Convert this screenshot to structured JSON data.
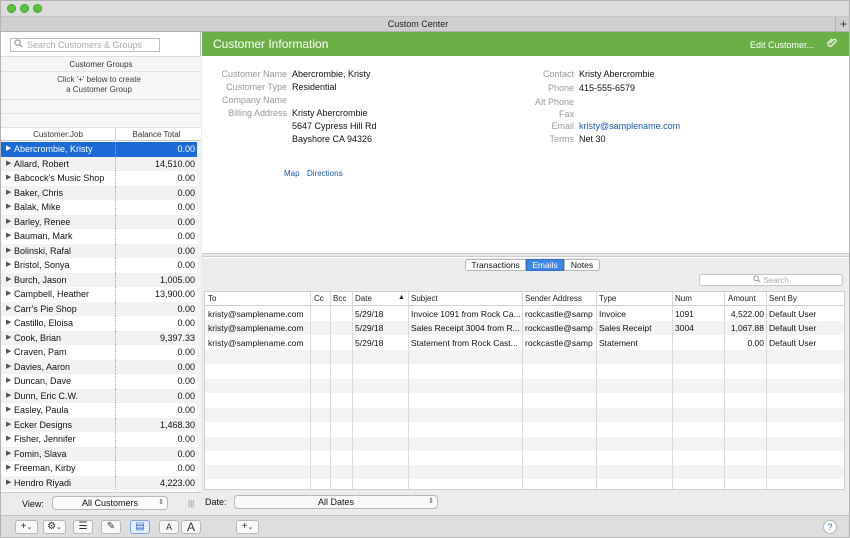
{
  "window": {
    "title": "Custom Center",
    "new_tab": "+"
  },
  "sidebar": {
    "search_placeholder": "Search Customers & Groups",
    "groups_header": "Customer Groups",
    "groups_hint": [
      "Click '+' below to create",
      "a Customer Group"
    ],
    "columns": [
      "Customer:Job",
      "Balance Total"
    ],
    "customers": [
      {
        "name": "Abercrombie, Kristy",
        "balance": "0.00",
        "selected": true
      },
      {
        "name": "Allard, Robert",
        "balance": "14,510.00"
      },
      {
        "name": "Babcock's Music Shop",
        "balance": "0.00"
      },
      {
        "name": "Baker, Chris",
        "balance": "0.00"
      },
      {
        "name": "Balak, Mike",
        "balance": "0.00"
      },
      {
        "name": "Barley, Renee",
        "balance": "0.00"
      },
      {
        "name": "Bauman, Mark",
        "balance": "0.00"
      },
      {
        "name": "Bolinski, Rafal",
        "balance": "0.00"
      },
      {
        "name": "Bristol, Sonya",
        "balance": "0.00"
      },
      {
        "name": "Burch, Jason",
        "balance": "1,005.00"
      },
      {
        "name": "Campbell, Heather",
        "balance": "13,900.00"
      },
      {
        "name": "Carr's Pie Shop",
        "balance": "0.00"
      },
      {
        "name": "Castillo, Eloisa",
        "balance": "0.00"
      },
      {
        "name": "Cook, Brian",
        "balance": "9,397.33"
      },
      {
        "name": "Craven, Pam",
        "balance": "0.00"
      },
      {
        "name": "Davies, Aaron",
        "balance": "0.00"
      },
      {
        "name": "Duncan, Dave",
        "balance": "0.00"
      },
      {
        "name": "Dunn, Eric C.W.",
        "balance": "0.00"
      },
      {
        "name": "Easley, Paula",
        "balance": "0.00"
      },
      {
        "name": "Ecker Designs",
        "balance": "1,468.30"
      },
      {
        "name": "Fisher, Jennifer",
        "balance": "0.00"
      },
      {
        "name": "Fomin, Slava",
        "balance": "0.00"
      },
      {
        "name": "Freeman, Kirby",
        "balance": "0.00"
      },
      {
        "name": "Hendro Riyadi",
        "balance": "4,223.00"
      }
    ],
    "view_label": "View:",
    "view_value": "All Customers"
  },
  "customer_info": {
    "header": "Customer Information",
    "edit": "Edit Customer...",
    "fields_left": [
      {
        "label": "Customer Name",
        "value": "Abercrombie, Kristy"
      },
      {
        "label": "Customer Type",
        "value": "Residential"
      },
      {
        "label": "Company Name",
        "value": ""
      },
      {
        "label": "Billing Address",
        "value": [
          "Kristy Abercrombie",
          "5647 Cypress Hill Rd",
          "Bayshore CA 94326"
        ]
      }
    ],
    "fields_right": [
      {
        "label": "Contact",
        "value": "Kristy Abercrombie"
      },
      {
        "label": "Phone",
        "value": "415-555-6579"
      },
      {
        "label": "Alt Phone",
        "value": ""
      },
      {
        "label": "Fax",
        "value": ""
      },
      {
        "label": "Email",
        "value": "kristy@samplename.com",
        "link": true
      },
      {
        "label": "Terms",
        "value": "Net 30"
      }
    ],
    "map": "Map",
    "directions": "Directions"
  },
  "tabs": [
    {
      "label": "Transactions",
      "active": false
    },
    {
      "label": "Emails",
      "active": true
    },
    {
      "label": "Notes",
      "active": false
    }
  ],
  "grid_search_placeholder": "Search",
  "emails": {
    "columns": [
      "To",
      "Cc",
      "Bcc",
      "Date",
      "Subject",
      "Sender Address",
      "Type",
      "Num",
      "Amount",
      "Sent By"
    ],
    "rows": [
      [
        "kristy@samplename.com",
        "",
        "",
        "5/29/18",
        "Invoice 1091 from Rock Ca...",
        "rockcastle@samp",
        "Invoice",
        "1091",
        "4,522.00",
        "Default User"
      ],
      [
        "kristy@samplename.com",
        "",
        "",
        "5/29/18",
        "Sales Receipt 3004 from R...",
        "rockcastle@samp",
        "Sales Receipt",
        "3004",
        "1,067.88",
        "Default User"
      ],
      [
        "kristy@samplename.com",
        "",
        "",
        "5/29/18",
        "Statement from Rock Cast...",
        "rockcastle@samp",
        "Statement",
        "",
        "0.00",
        "Default User"
      ]
    ]
  },
  "date_filter": {
    "label": "Date:",
    "value": "All Dates"
  },
  "bottom_toolbar": {
    "font_small": "A",
    "font_large": "A",
    "help": "?"
  }
}
